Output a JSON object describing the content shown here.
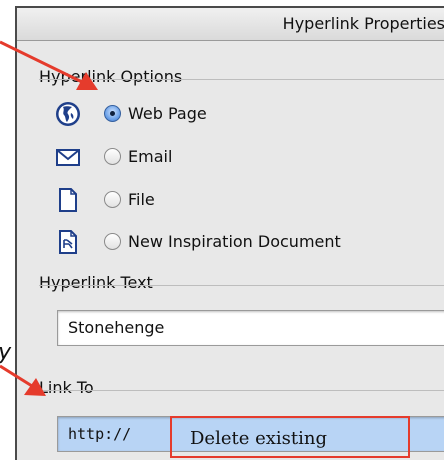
{
  "window": {
    "title": "Hyperlink Properties"
  },
  "hyperlink_options": {
    "title": "Hyperlink Options",
    "options": [
      {
        "label": "Web Page",
        "icon": "globe-icon",
        "checked": true
      },
      {
        "label": "Email",
        "icon": "envelope-icon",
        "checked": false
      },
      {
        "label": "File",
        "icon": "file-icon",
        "checked": false
      },
      {
        "label": "New Inspiration Document",
        "icon": "inspiration-document-icon",
        "checked": false
      }
    ]
  },
  "hyperlink_text": {
    "title": "Hyperlink Text",
    "value": "Stonehenge"
  },
  "link_to": {
    "title": "Link To",
    "value": "http://"
  },
  "annotation": {
    "callout_text": "Delete existing",
    "side_text": "ly",
    "color": "#e53b2c"
  }
}
